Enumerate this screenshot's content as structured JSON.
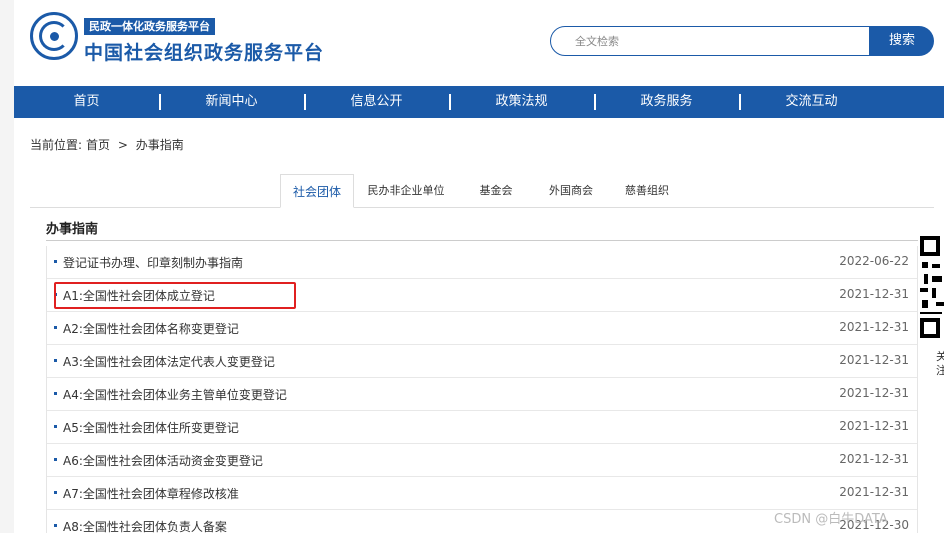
{
  "header": {
    "badge": "民政一体化政务服务平台",
    "site_title": "中国社会组织政务服务平台",
    "search_placeholder": "全文检索",
    "search_button": "搜索"
  },
  "nav": [
    "首页",
    "新闻中心",
    "信息公开",
    "政策法规",
    "政务服务",
    "交流互动"
  ],
  "breadcrumb": {
    "prefix": "当前位置:",
    "home": "首页",
    "sep": ">",
    "current": "办事指南"
  },
  "tabs": [
    "社会团体",
    "民办非企业单位",
    "基金会",
    "外国商会",
    "慈善组织"
  ],
  "active_tab": "社会团体",
  "section_title": "办事指南",
  "items": [
    {
      "title": "登记证书办理、印章刻制办事指南",
      "date": "2022-06-22"
    },
    {
      "title": "A1:全国性社会团体成立登记",
      "date": "2021-12-31"
    },
    {
      "title": "A2:全国性社会团体名称变更登记",
      "date": "2021-12-31"
    },
    {
      "title": "A3:全国性社会团体法定代表人变更登记",
      "date": "2021-12-31"
    },
    {
      "title": "A4:全国性社会团体业务主管单位变更登记",
      "date": "2021-12-31"
    },
    {
      "title": "A5:全国性社会团体住所变更登记",
      "date": "2021-12-31"
    },
    {
      "title": "A6:全国性社会团体活动资金变更登记",
      "date": "2021-12-31"
    },
    {
      "title": "A7:全国性社会团体章程修改核准",
      "date": "2021-12-31"
    },
    {
      "title": "A8:全国性社会团体负责人备案",
      "date": "2021-12-30"
    }
  ],
  "side_text": "关注",
  "watermark": "CSDN @白牛DATA",
  "colors": {
    "brand": "#1b5aa8",
    "highlight": "#e02020"
  }
}
